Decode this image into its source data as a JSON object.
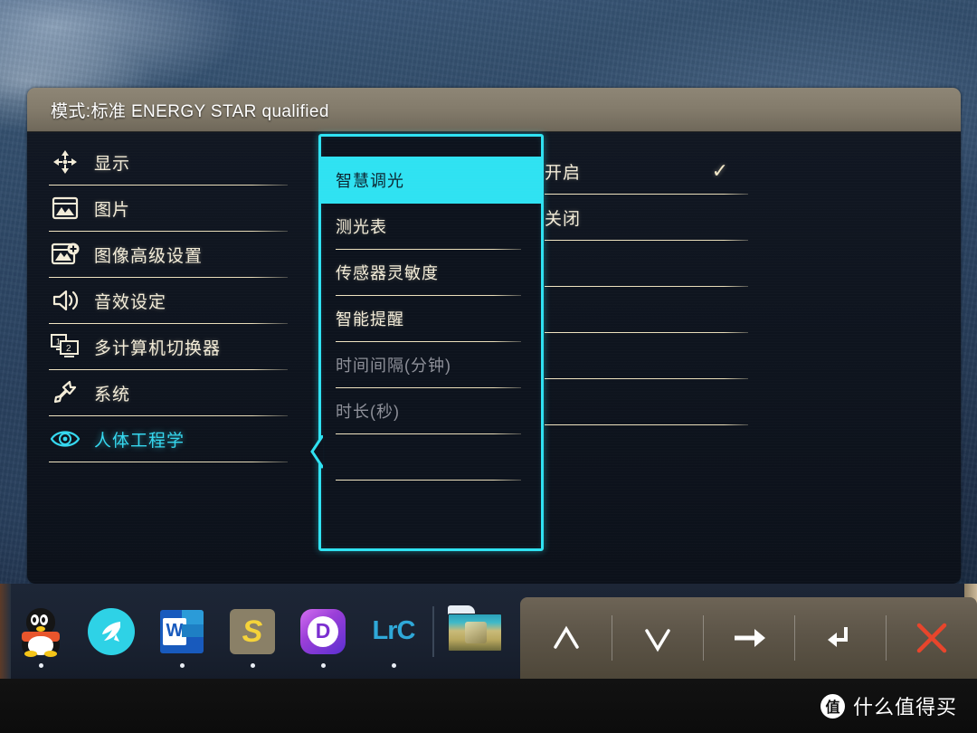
{
  "osd": {
    "title": "模式:标准  ENERGY STAR qualified",
    "sidebar": [
      {
        "label": "显示",
        "icon": "shrink-arrows-icon",
        "active": false
      },
      {
        "label": "图片",
        "icon": "picture-icon",
        "active": false
      },
      {
        "label": "图像高级设置",
        "icon": "picture-plus-icon",
        "active": false
      },
      {
        "label": "音效设定",
        "icon": "speaker-icon",
        "active": false
      },
      {
        "label": "多计算机切换器",
        "icon": "kvm-monitors-icon",
        "active": false
      },
      {
        "label": "系统",
        "icon": "wrench-icon",
        "active": false
      },
      {
        "label": "人体工程学",
        "icon": "eye-icon",
        "active": true
      }
    ],
    "middle": [
      {
        "label": "智慧调光",
        "state": "highlighted"
      },
      {
        "label": "测光表",
        "state": "normal"
      },
      {
        "label": "传感器灵敏度",
        "state": "normal"
      },
      {
        "label": "智能提醒",
        "state": "normal"
      },
      {
        "label": "时间间隔(分钟)",
        "state": "disabled"
      },
      {
        "label": "时长(秒)",
        "state": "disabled"
      },
      {
        "label": "",
        "state": "empty"
      },
      {
        "label": "",
        "state": "empty"
      }
    ],
    "right": [
      {
        "label": "开启",
        "checked": true
      },
      {
        "label": "关闭",
        "checked": false
      },
      {
        "label": "",
        "checked": false
      },
      {
        "label": "",
        "checked": false
      },
      {
        "label": "",
        "checked": false
      },
      {
        "label": "",
        "checked": false
      }
    ],
    "colors": {
      "accent_cyan": "#2FE2F2",
      "text_cream": "#F3ECD8",
      "disabled_gray": "#8E9099",
      "panel_bg": "#0E141E",
      "header_bg": "#837B6B"
    }
  },
  "osd_buttons": [
    {
      "name": "up",
      "glyph": "∧",
      "label": "向上"
    },
    {
      "name": "down",
      "glyph": "∨",
      "label": "向下"
    },
    {
      "name": "confirm",
      "glyph": "→",
      "label": "确认"
    },
    {
      "name": "back",
      "glyph": "↰",
      "label": "返回"
    },
    {
      "name": "exit",
      "glyph": "✕",
      "label": "退出"
    }
  ],
  "taskbar": {
    "items": [
      {
        "name": "qq",
        "label": "QQ",
        "running": true
      },
      {
        "name": "cyan-app",
        "label": "",
        "running": false
      },
      {
        "name": "word",
        "label": "W",
        "running": true
      },
      {
        "name": "sublime-text",
        "label": "S",
        "running": true
      },
      {
        "name": "d-app",
        "label": "D",
        "running": true
      },
      {
        "name": "lightroom",
        "label": "LrC",
        "running": true
      }
    ],
    "thumbnail": {
      "name": "window-preview",
      "label": ""
    }
  },
  "watermark": {
    "badge": "值",
    "text": "什么值得买"
  }
}
